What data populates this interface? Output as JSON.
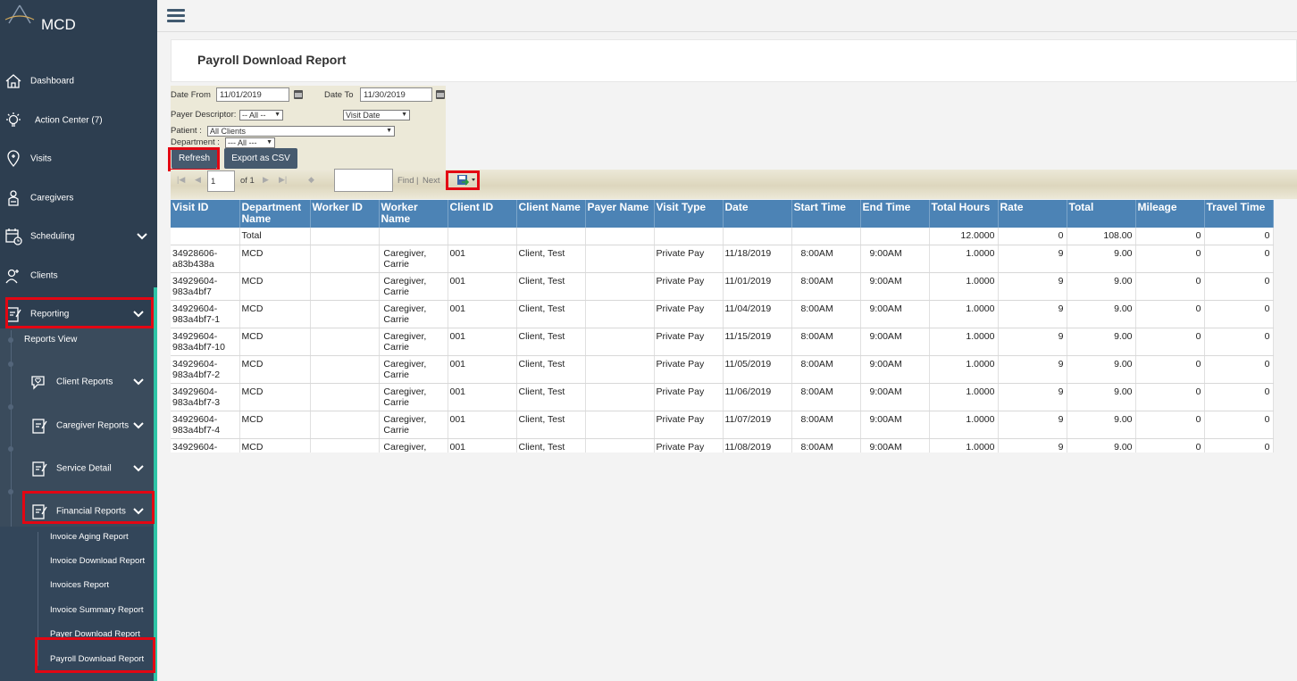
{
  "app": {
    "name": "MCD"
  },
  "sidebar": {
    "items": [
      {
        "label": "Dashboard"
      },
      {
        "label": "Action Center (7)"
      },
      {
        "label": "Visits"
      },
      {
        "label": "Caregivers"
      },
      {
        "label": "Scheduling"
      },
      {
        "label": "Clients"
      },
      {
        "label": "Reporting"
      }
    ],
    "reporting": {
      "reports_view": "Reports View",
      "groups": [
        "Client Reports",
        "Caregiver Reports",
        "Service Detail",
        "Financial Reports"
      ],
      "financial_items": [
        "Invoice Aging Report",
        "Invoice Download Report",
        "Invoices Report",
        "Invoice Summary Report",
        "Payer Download Report",
        "Payroll Download Report"
      ]
    }
  },
  "page": {
    "title": "Payroll Download Report"
  },
  "filters": {
    "date_from_label": "Date From",
    "date_from": "11/01/2019",
    "date_to_label": "Date To",
    "date_to": "11/30/2019",
    "payer_descriptor_label": "Payer Descriptor:",
    "payer_descriptor": "-- All --",
    "date_type": "Visit Date",
    "patient_label": "Patient :",
    "patient": "All Clients",
    "department_label": "Department :",
    "department": "--- All ---",
    "refresh": "Refresh",
    "export_csv": "Export as CSV"
  },
  "report_toolbar": {
    "page": "1",
    "of_pages": "of 1",
    "find": "Find",
    "separator": "|",
    "next": "Next"
  },
  "table": {
    "headers": [
      "Visit ID",
      "Department Name",
      "Worker ID",
      "Worker Name",
      "Client ID",
      "Client Name",
      "Payer Name",
      "Visit Type",
      "Date",
      "Start Time",
      "End Time",
      "Total Hours",
      "Rate",
      "Total",
      "Mileage",
      "Travel Time"
    ],
    "total_row": {
      "label": "Total",
      "total_hours": "12.0000",
      "rate": "0",
      "total": "108.00",
      "mileage": "0",
      "travel_time": "0"
    },
    "rows": [
      {
        "visit_id": "34928606-\na83b438a",
        "dept": "MCD",
        "worker_id": "",
        "worker": " Caregiver,\n Carrie",
        "client_id": "001",
        "client": "Client, Test",
        "payer": "",
        "type": "Private Pay",
        "date": "11/18/2019",
        "start": "8:00AM",
        "end": "9:00AM",
        "hours": "1.0000",
        "rate": "9",
        "total": "9.00",
        "mileage": "0",
        "travel": "0"
      },
      {
        "visit_id": "34929604-\n983a4bf7",
        "dept": "MCD",
        "worker_id": "",
        "worker": " Caregiver,\n Carrie",
        "client_id": "001",
        "client": "Client, Test",
        "payer": "",
        "type": "Private Pay",
        "date": "11/01/2019",
        "start": "8:00AM",
        "end": "9:00AM",
        "hours": "1.0000",
        "rate": "9",
        "total": "9.00",
        "mileage": "0",
        "travel": "0"
      },
      {
        "visit_id": "34929604-\n983a4bf7-1",
        "dept": "MCD",
        "worker_id": "",
        "worker": " Caregiver,\n Carrie",
        "client_id": "001",
        "client": "Client, Test",
        "payer": "",
        "type": "Private Pay",
        "date": "11/04/2019",
        "start": "8:00AM",
        "end": "9:00AM",
        "hours": "1.0000",
        "rate": "9",
        "total": "9.00",
        "mileage": "0",
        "travel": "0"
      },
      {
        "visit_id": "34929604-\n983a4bf7-10",
        "dept": "MCD",
        "worker_id": "",
        "worker": " Caregiver,\n Carrie",
        "client_id": "001",
        "client": "Client, Test",
        "payer": "",
        "type": "Private Pay",
        "date": "11/15/2019",
        "start": "8:00AM",
        "end": "9:00AM",
        "hours": "1.0000",
        "rate": "9",
        "total": "9.00",
        "mileage": "0",
        "travel": "0"
      },
      {
        "visit_id": "34929604-\n983a4bf7-2",
        "dept": "MCD",
        "worker_id": "",
        "worker": " Caregiver,\n Carrie",
        "client_id": "001",
        "client": "Client, Test",
        "payer": "",
        "type": "Private Pay",
        "date": "11/05/2019",
        "start": "8:00AM",
        "end": "9:00AM",
        "hours": "1.0000",
        "rate": "9",
        "total": "9.00",
        "mileage": "0",
        "travel": "0"
      },
      {
        "visit_id": "34929604-\n983a4bf7-3",
        "dept": "MCD",
        "worker_id": "",
        "worker": " Caregiver,\n Carrie",
        "client_id": "001",
        "client": "Client, Test",
        "payer": "",
        "type": "Private Pay",
        "date": "11/06/2019",
        "start": "8:00AM",
        "end": "9:00AM",
        "hours": "1.0000",
        "rate": "9",
        "total": "9.00",
        "mileage": "0",
        "travel": "0"
      },
      {
        "visit_id": "34929604-\n983a4bf7-4",
        "dept": "MCD",
        "worker_id": "",
        "worker": " Caregiver,\n Carrie",
        "client_id": "001",
        "client": "Client, Test",
        "payer": "",
        "type": "Private Pay",
        "date": "11/07/2019",
        "start": "8:00AM",
        "end": "9:00AM",
        "hours": "1.0000",
        "rate": "9",
        "total": "9.00",
        "mileage": "0",
        "travel": "0"
      },
      {
        "visit_id": "34929604-",
        "dept": "MCD",
        "worker_id": "",
        "worker": " Caregiver,",
        "client_id": "001",
        "client": "Client, Test",
        "payer": "",
        "type": "Private Pay",
        "date": "11/08/2019",
        "start": "8:00AM",
        "end": "9:00AM",
        "hours": "1.0000",
        "rate": "9",
        "total": "9.00",
        "mileage": "0",
        "travel": "0"
      }
    ]
  },
  "colors": {
    "sidebar": "#2d3e50",
    "accent": "#2ec4a6",
    "table_header": "#4c83b5",
    "highlight": "#e30613"
  }
}
